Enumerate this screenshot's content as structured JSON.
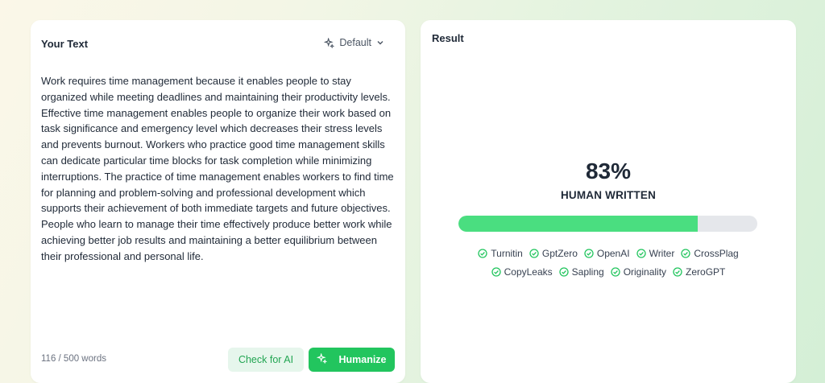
{
  "input_panel": {
    "title": "Your Text",
    "mode_label": "Default",
    "text": "Work requires time management because it enables people to stay organized while meeting deadlines and maintaining their productivity levels. Effective time management enables people to organize their work based on task significance and emergency level which decreases their stress levels and prevents burnout. Workers who practice good time management skills can dedicate particular time blocks for task completion while minimizing interruptions. The practice of time management enables workers to find time for planning and problem-solving and professional development which supports their achievement of both immediate targets and future objectives. People who learn to manage their time effectively produce better work while achieving better job results and maintaining a better equilibrium between their professional and personal life.",
    "word_count": "116 / 500 words",
    "check_button": "Check for AI",
    "humanize_button": "Humanize"
  },
  "result_panel": {
    "title": "Result",
    "percent": "83%",
    "label": "HUMAN WRITTEN",
    "progress": 0.8,
    "detectors_row1": [
      "Turnitin",
      "GptZero",
      "OpenAI",
      "Writer",
      "CrossPlag"
    ],
    "detectors_row2": [
      "CopyLeaks",
      "Sapling",
      "Originality",
      "ZeroGPT"
    ]
  },
  "colors": {
    "accent": "#22c55e",
    "progress_fill": "#4ade80",
    "progress_track": "#e5e7eb",
    "check_icon": "#22c55e"
  },
  "icons": {
    "mode": "sparkle-icon",
    "mode_dropdown": "chevron-down-icon",
    "humanize": "sparkle-icon",
    "detector": "check-circle-icon"
  }
}
